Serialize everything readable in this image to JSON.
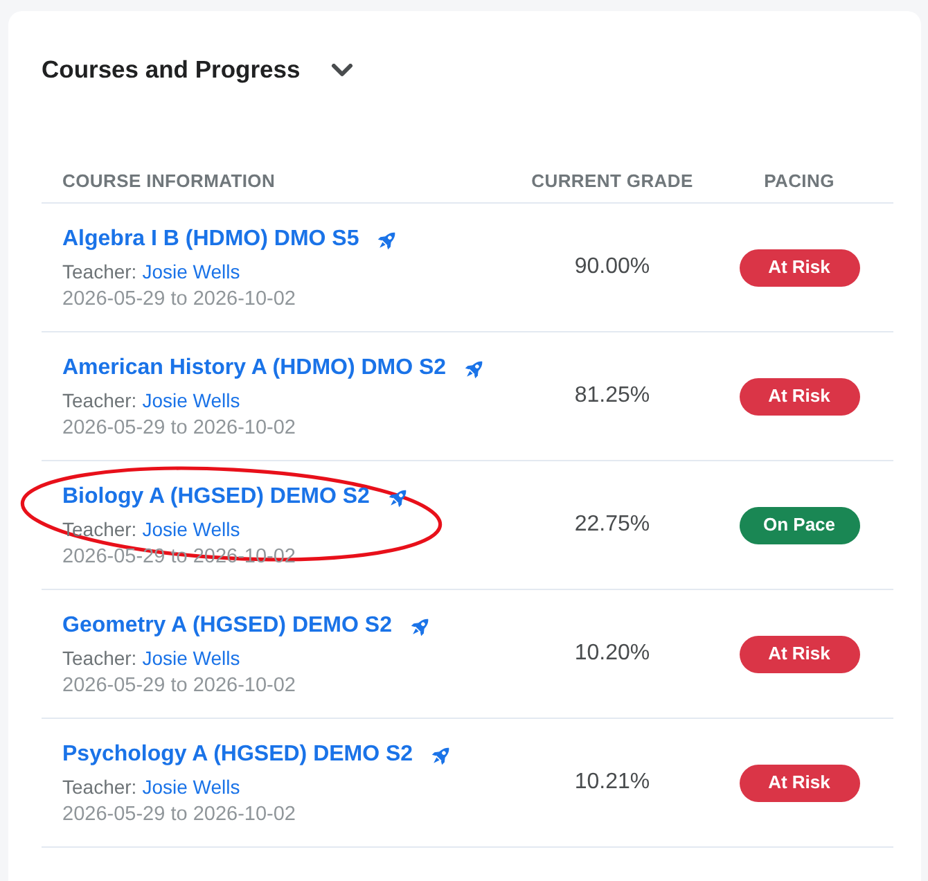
{
  "card": {
    "title": "Courses and Progress"
  },
  "table": {
    "columns": [
      "COURSE INFORMATION",
      "CURRENT GRADE",
      "PACING"
    ],
    "rows": [
      {
        "course": "Algebra I B (HDMO) DMO S5",
        "teacher_label": "Teacher:",
        "teacher": "Josie Wells",
        "dates": "2026-05-29 to 2026-10-02",
        "grade": "90.00%",
        "pacing": {
          "label": "At Risk",
          "color": "#da3547"
        },
        "highlighted": false
      },
      {
        "course": "American History A (HDMO) DMO S2",
        "teacher_label": "Teacher:",
        "teacher": "Josie Wells",
        "dates": "2026-05-29 to 2026-10-02",
        "grade": "81.25%",
        "pacing": {
          "label": "At Risk",
          "color": "#da3547"
        },
        "highlighted": false
      },
      {
        "course": "Biology A (HGSED) DEMO S2",
        "teacher_label": "Teacher:",
        "teacher": "Josie Wells",
        "dates": "2026-05-29 to 2026-10-02",
        "grade": "22.75%",
        "pacing": {
          "label": "On Pace",
          "color": "#1a8754"
        },
        "highlighted": true
      },
      {
        "course": "Geometry A (HGSED) DEMO S2",
        "teacher_label": "Teacher:",
        "teacher": "Josie Wells",
        "dates": "2026-05-29 to 2026-10-02",
        "grade": "10.20%",
        "pacing": {
          "label": "At Risk",
          "color": "#da3547"
        },
        "highlighted": false
      },
      {
        "course": "Psychology A (HGSED) DEMO S2",
        "teacher_label": "Teacher:",
        "teacher": "Josie Wells",
        "dates": "2026-05-29 to 2026-10-02",
        "grade": "10.21%",
        "pacing": {
          "label": "At Risk",
          "color": "#da3547"
        },
        "highlighted": false
      }
    ]
  }
}
